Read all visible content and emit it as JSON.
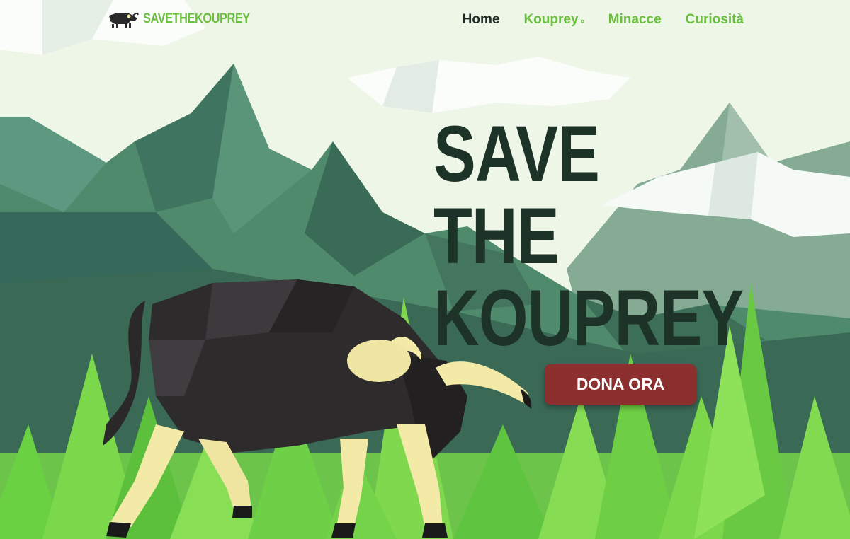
{
  "brand": {
    "name": "SAVETHEKOUPREY",
    "logo_icon": "kouprey-icon"
  },
  "nav": {
    "items": [
      {
        "label": "Home",
        "active": true
      },
      {
        "label": "Kouprey",
        "has_dropdown": true,
        "dropdown_icon": "double-chevron-down-icon"
      },
      {
        "label": "Minacce"
      },
      {
        "label": "Curiosità"
      }
    ]
  },
  "hero": {
    "title_lines": [
      "SAVE",
      "THE",
      "KOUPREY"
    ],
    "cta_label": "DONA ORA"
  },
  "colors": {
    "sky": "#eef7e7",
    "mountain_dark": "#3e6f5a",
    "mountain_mid": "#4f8a6d",
    "mountain_light": "#86ab94",
    "forest_bright": "#78d64a",
    "title": "#1d3327",
    "nav_link": "#6abf3f",
    "nav_active": "#1f2a24",
    "cta": "#8b2f2f"
  }
}
